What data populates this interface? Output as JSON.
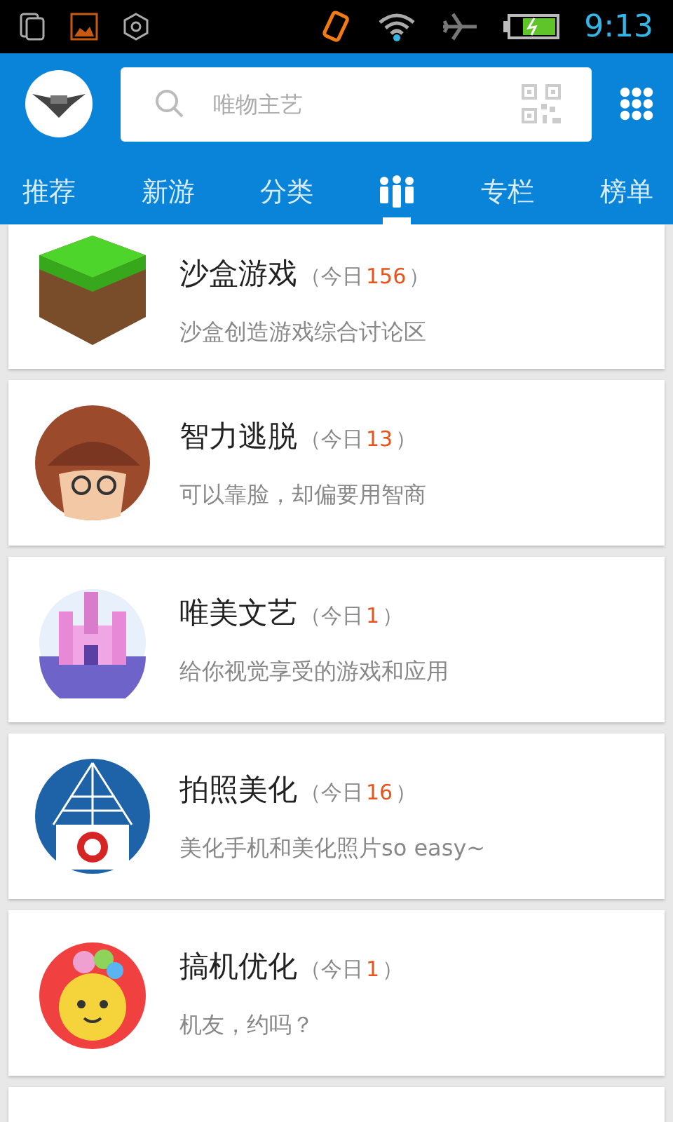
{
  "status_bar": {
    "time": "9:13"
  },
  "search": {
    "placeholder": "唯物主艺"
  },
  "tabs": [
    {
      "kind": "text",
      "label": "推荐",
      "selected": false
    },
    {
      "kind": "text",
      "label": "新游",
      "selected": false
    },
    {
      "kind": "text",
      "label": "分类",
      "selected": false
    },
    {
      "kind": "icon",
      "selected": true
    },
    {
      "kind": "text",
      "label": "专栏",
      "selected": false
    },
    {
      "kind": "text",
      "label": "榜单",
      "selected": false
    }
  ],
  "groups": [
    {
      "kind": "cube",
      "name": "沙盒游戏",
      "count_prefix": "（今日",
      "count": "156",
      "count_suffix": "）",
      "description": "沙盒创造游戏综合讨论区"
    },
    {
      "kind": "detective",
      "name": "智力逃脱",
      "count_prefix": "（今日",
      "count": "13",
      "count_suffix": "）",
      "description": "可以靠脸，却偏要用智商"
    },
    {
      "kind": "castle",
      "name": "唯美文艺",
      "count_prefix": "（今日",
      "count": "1",
      "count_suffix": "）",
      "description": "给你视觉享受的游戏和应用"
    },
    {
      "kind": "camera",
      "name": "拍照美化",
      "count_prefix": "（今日",
      "count": "16",
      "count_suffix": "）",
      "description": "美化手机和美化照片so easy~"
    },
    {
      "kind": "mascot",
      "name": "搞机优化",
      "count_prefix": "（今日",
      "count": "1",
      "count_suffix": "）",
      "description": "机友，约吗？"
    }
  ]
}
